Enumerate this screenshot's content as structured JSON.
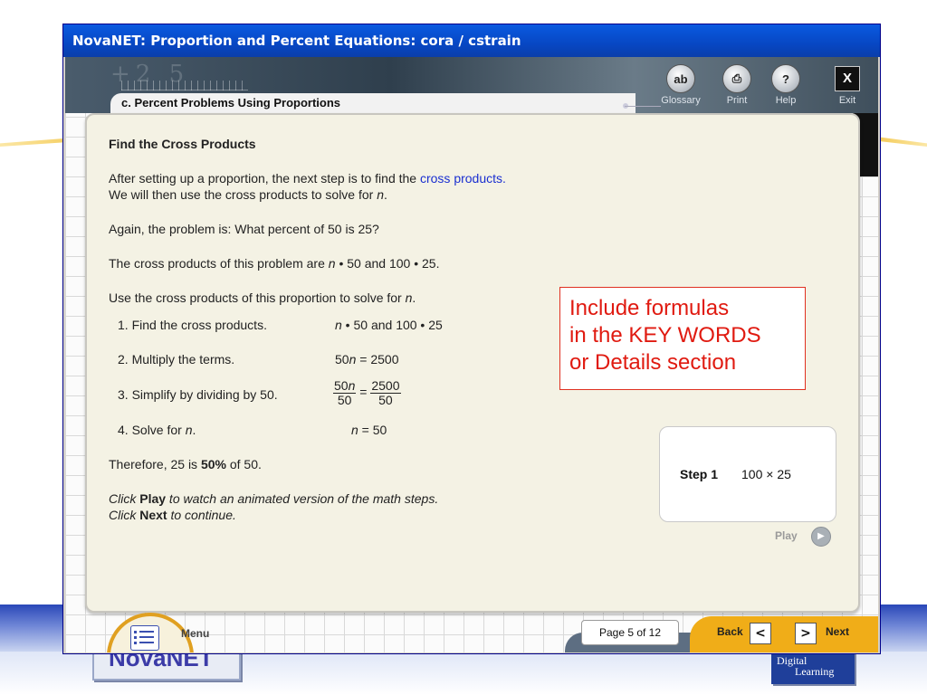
{
  "window": {
    "title": "NovaNET: Proportion and Percent Equations: cora / cstrain"
  },
  "header": {
    "lesson_title": "c. Percent Problems Using Proportions",
    "tools": [
      {
        "label": "Glossary",
        "icon": "glossary-icon",
        "glyph": "ab"
      },
      {
        "label": "Print",
        "icon": "print-icon",
        "glyph": "⎙"
      },
      {
        "label": "Help",
        "icon": "help-icon",
        "glyph": "?"
      },
      {
        "label": "Exit",
        "icon": "exit-icon",
        "glyph": "X"
      }
    ]
  },
  "content": {
    "heading": "Find the Cross Products",
    "p1a": "After setting up a proportion, the next step is to find the ",
    "p1_link": "cross products.",
    "p1b": "We will then use the cross products to solve for ",
    "p1b_var": "n",
    "p1b_end": ".",
    "p2": "Again, the problem is: What percent of 50 is 25?",
    "p3a": "The cross products of this problem are ",
    "p3_var": "n",
    "p3b": " • 50 and 100 • 25.",
    "p4a": "Use the cross products of this proportion to solve for ",
    "p4_var": "n",
    "p4_end": ".",
    "steps": {
      "s1_label": "1. Find the cross products.",
      "s1_var": "n",
      "s1_expr": " • 50 and 100 • 25",
      "s2_label": "2. Multiply the terms.",
      "s2_a": "50",
      "s2_var": "n",
      "s2_b": " = 2500",
      "s3_label": "3. Simplify by dividing by 50.",
      "s3_num1": "50",
      "s3_num1_var": "n",
      "s3_den1": "50",
      "s3_eq": "=",
      "s3_num2": "2500",
      "s3_den2": "50",
      "s4_label_a": "4. Solve for ",
      "s4_label_var": "n",
      "s4_label_end": ".",
      "s4_var": "n",
      "s4_expr": " = 50"
    },
    "therefore_a": "Therefore, 25 is ",
    "therefore_bold": "50%",
    "therefore_b": "of 50.",
    "click1_a": "Click ",
    "click1_bold": "Play",
    "click1_b": " to watch an animated version of the math steps.",
    "click2_a": "Click ",
    "click2_bold": "Next",
    "click2_b": " to continue."
  },
  "annotation": {
    "line1": "Include formulas",
    "line2": "in the KEY WORDS",
    "line3": "or Details section"
  },
  "step_panel": {
    "label": "Step 1",
    "expr": "100 × 25",
    "play_label": "Play"
  },
  "nav": {
    "menu_label": "Menu",
    "page": "Page 5 of 12",
    "back_label": "Back",
    "next_label": "Next"
  },
  "branding": {
    "left_logo": "NovaNET",
    "right_logo_l1": "Digital",
    "right_logo_l2": "Learning"
  },
  "colors": {
    "title_blue": "#0747c4",
    "nav_orange": "#f0ad18",
    "link_blue": "#1a2fd0",
    "annotation_red": "#e01a10"
  }
}
